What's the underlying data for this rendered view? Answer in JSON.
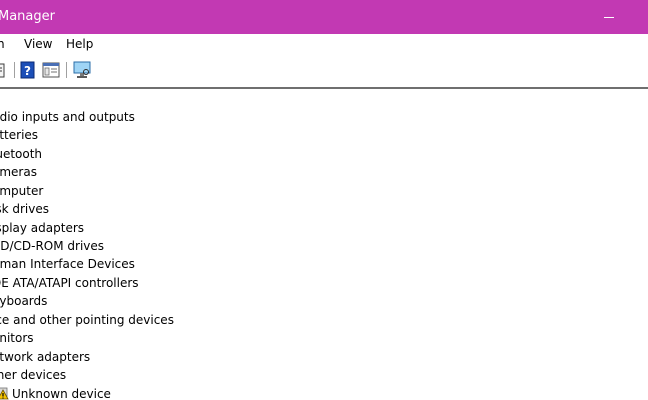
{
  "window": {
    "title": "Manager",
    "accent_color": "#c239b3"
  },
  "menu": {
    "items": [
      "n",
      "View",
      "Help"
    ]
  },
  "toolbar": {
    "buttons": [
      "properties-icon",
      "help-icon",
      "view-icon",
      "scan-hardware-icon"
    ]
  },
  "tree": {
    "items": [
      "udio inputs and outputs",
      "atteries",
      "luetooth",
      "ameras",
      "omputer",
      "isk drives",
      "isplay adapters",
      "VD/CD-ROM drives",
      "uman Interface Devices",
      "DE ATA/ATAPI controllers",
      "eyboards",
      "ice and other pointing devices",
      "onitors",
      "etwork adapters",
      "ther devices"
    ],
    "child": {
      "label": "Unknown device",
      "icon": "warning-device-icon"
    }
  }
}
